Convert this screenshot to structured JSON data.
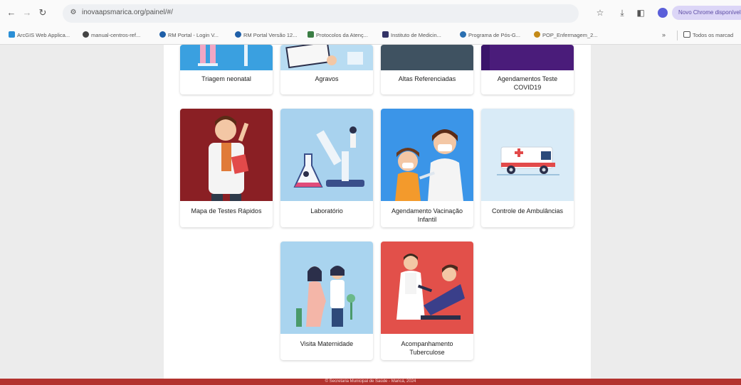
{
  "browser": {
    "url": "inovaapsmarica.org/painel/#/",
    "new_chrome_label": "Novo Chrome disponível",
    "bookmarks": [
      {
        "label": "ArcGIS Web Applica...",
        "color": "#2a8fd6"
      },
      {
        "label": "manual-centros-ref...",
        "color": "#444444"
      },
      {
        "label": "RM Portal - Login V...",
        "color": "#1f5fa8"
      },
      {
        "label": "RM Portal Versão 12...",
        "color": "#1f5fa8"
      },
      {
        "label": "Protocolos da Atenç...",
        "color": "#3a7d44"
      },
      {
        "label": "Instituto de Medicin...",
        "color": "#333366"
      },
      {
        "label": "Programa de Pós-G...",
        "color": "#2a6fb0"
      },
      {
        "label": "POP_Enfermagem_2...",
        "color": "#c48a18"
      }
    ],
    "all_bookmarks_label": "Todos os marcad"
  },
  "cards": [
    {
      "label": "Triagem neonatal",
      "icon": "triagem-neonatal-illustration"
    },
    {
      "label": "Agravos",
      "icon": "agravos-illustration"
    },
    {
      "label": "Altas Referenciadas",
      "icon": "altas-illustration"
    },
    {
      "label": "Agendamentos Teste COVID19",
      "icon": "covid-test-illustration"
    },
    {
      "label": "Mapa de Testes Rápidos",
      "icon": "doctor-illustration"
    },
    {
      "label": "Laboratório",
      "icon": "microscope-illustration"
    },
    {
      "label": "Agendamento Vacinação Infantil",
      "icon": "vaccination-illustration"
    },
    {
      "label": "Controle de Ambulâncias",
      "icon": "ambulance-illustration"
    },
    {
      "label": "Visita Maternidade",
      "icon": "maternity-illustration"
    },
    {
      "label": "Acompanhamento Tuberculose",
      "icon": "tuberculosis-illustration"
    }
  ],
  "footer": {
    "text": "© Secretaria Municipal de Saúde - Maricá, 2024"
  },
  "colors": {
    "footer": "#b3322e",
    "accent_red": "#e2504a",
    "accent_blue": "#3b95e8"
  }
}
